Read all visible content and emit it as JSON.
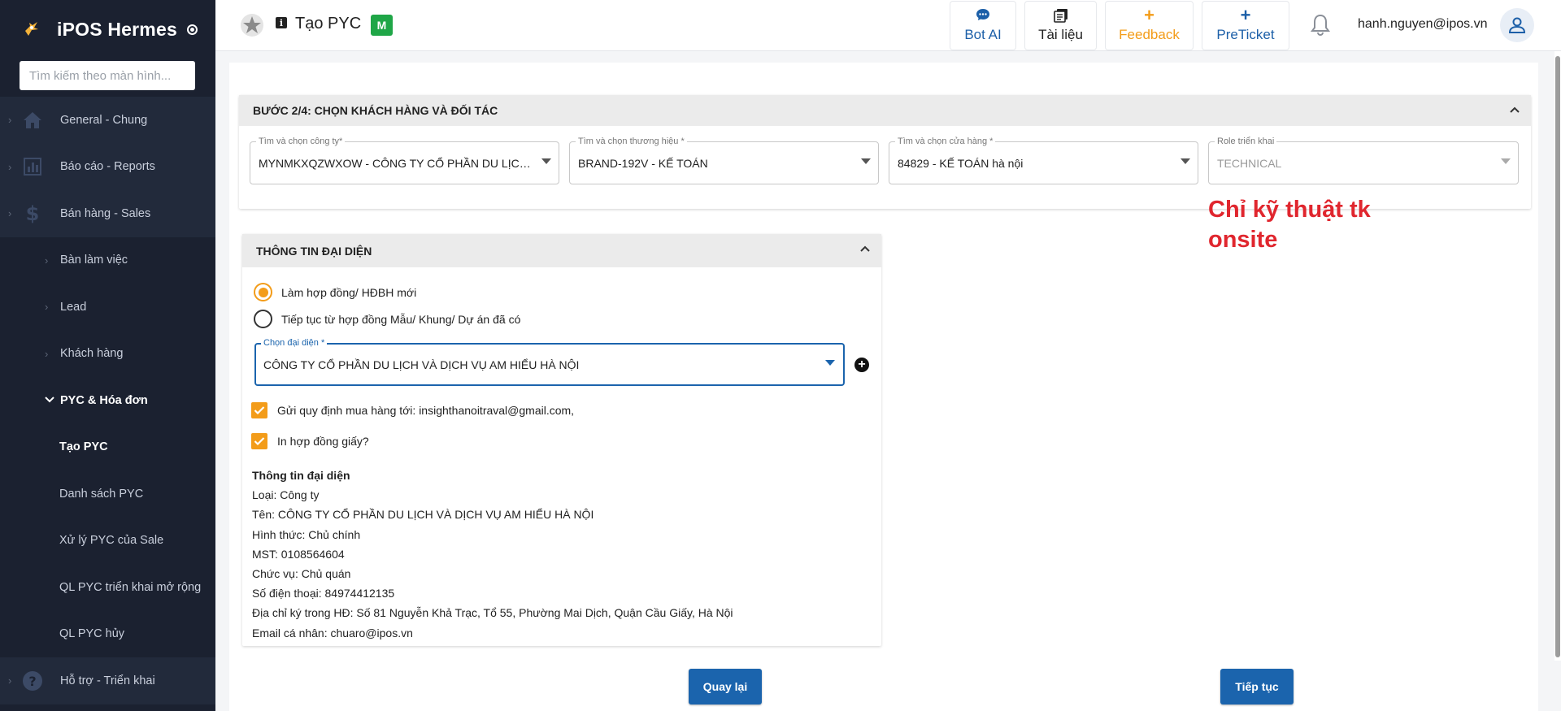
{
  "sidebar": {
    "title": "iPOS Hermes",
    "search_placeholder": "Tìm kiếm theo màn hình...",
    "items": [
      {
        "label": "General - Chung",
        "icon": "home-icon"
      },
      {
        "label": "Báo cáo - Reports",
        "icon": "report-chart-icon"
      },
      {
        "label": "Bán hàng - Sales",
        "icon": "dollar-icon"
      },
      {
        "label": "Bàn làm việc"
      },
      {
        "label": "Lead"
      },
      {
        "label": "Khách hàng"
      },
      {
        "label": "PYC & Hóa đơn"
      },
      {
        "label": "Tạo PYC"
      },
      {
        "label": "Danh sách PYC"
      },
      {
        "label": "Xử lý PYC của Sale"
      },
      {
        "label": "QL PYC triển khai mở rộng"
      },
      {
        "label": "QL PYC hủy"
      },
      {
        "label": "Hỗ trợ - Triển khai",
        "icon": "help-icon"
      }
    ]
  },
  "header": {
    "info_glyph": "i",
    "title": "Tạo PYC",
    "badge": "M",
    "buttons": [
      {
        "label": "Bot AI",
        "icon": "chat-icon"
      },
      {
        "label": "Tài liệu",
        "icon": "document-icon"
      },
      {
        "label": "Feedback",
        "icon": "plus-icon"
      },
      {
        "label": "PreTicket",
        "icon": "plus-icon"
      }
    ],
    "plus_glyph": "+",
    "user_email": "hanh.nguyen@ipos.vn"
  },
  "step": {
    "title": "BƯỚC 2/4: CHỌN KHÁCH HÀNG VÀ ĐỐI TÁC",
    "fields": [
      {
        "label": "Tìm và chọn công ty*",
        "value": "MYNMKXQZWXOW - CÔNG TY CỔ PHẦN DU LỊCH VÀ DỊCH VỤ AM HIỂU HÀ NỘI"
      },
      {
        "label": "Tìm và chọn thương hiệu *",
        "value": "BRAND-192V - KẾ TOÁN"
      },
      {
        "label": "Tìm và chọn cửa hàng *",
        "value": "84829 - KẾ TOÁN hà nội"
      },
      {
        "label": "Role triển khai",
        "value": "TECHNICAL"
      }
    ]
  },
  "note": {
    "line1": "Chỉ kỹ thuật tk",
    "line2": "onsite"
  },
  "rep": {
    "title": "THÔNG TIN ĐẠI DIỆN",
    "radio_new": "Làm hợp đồng/ HĐBH mới",
    "radio_continue": "Tiếp tục từ hợp đồng Mẫu/ Khung/ Dự án đã có",
    "select_label": "Chọn đại diện *",
    "select_value": "CÔNG TY CỔ PHẦN DU LỊCH VÀ DỊCH VỤ AM HIỂU HÀ NỘI",
    "add_glyph": "+",
    "chk_email": "Gửi quy định mua hàng tới: insighthanoitraval@gmail.com,",
    "chk_paper": "In hợp đồng giấy?",
    "info": {
      "heading": "Thông tin đại diện",
      "type": "Loại: Công ty",
      "name": "Tên: CÔNG TY CỔ PHẦN DU LỊCH VÀ DỊCH VỤ AM HIỂU HÀ NỘI",
      "form": "Hình thức: Chủ chính",
      "tax": "MST: 0108564604",
      "position": "Chức vụ: Chủ quán",
      "phone": "Số điện thoại: 84974412135",
      "address": "Địa chỉ ký trong HĐ: Số 81 Nguyễn Khả Trạc, Tổ 55, Phường Mai Dịch, Quận Cầu Giấy, Hà Nội",
      "email": "Email cá nhân: chuaro@ipos.vn"
    }
  },
  "actions": {
    "back": "Quay lại",
    "next": "Tiếp tục"
  },
  "colors": {
    "sidebar_bg": "#1b2130",
    "primary": "#1b64ad",
    "accent_orange": "#f39c19",
    "note_red": "#e0262e",
    "badge_green": "#1fa647"
  }
}
